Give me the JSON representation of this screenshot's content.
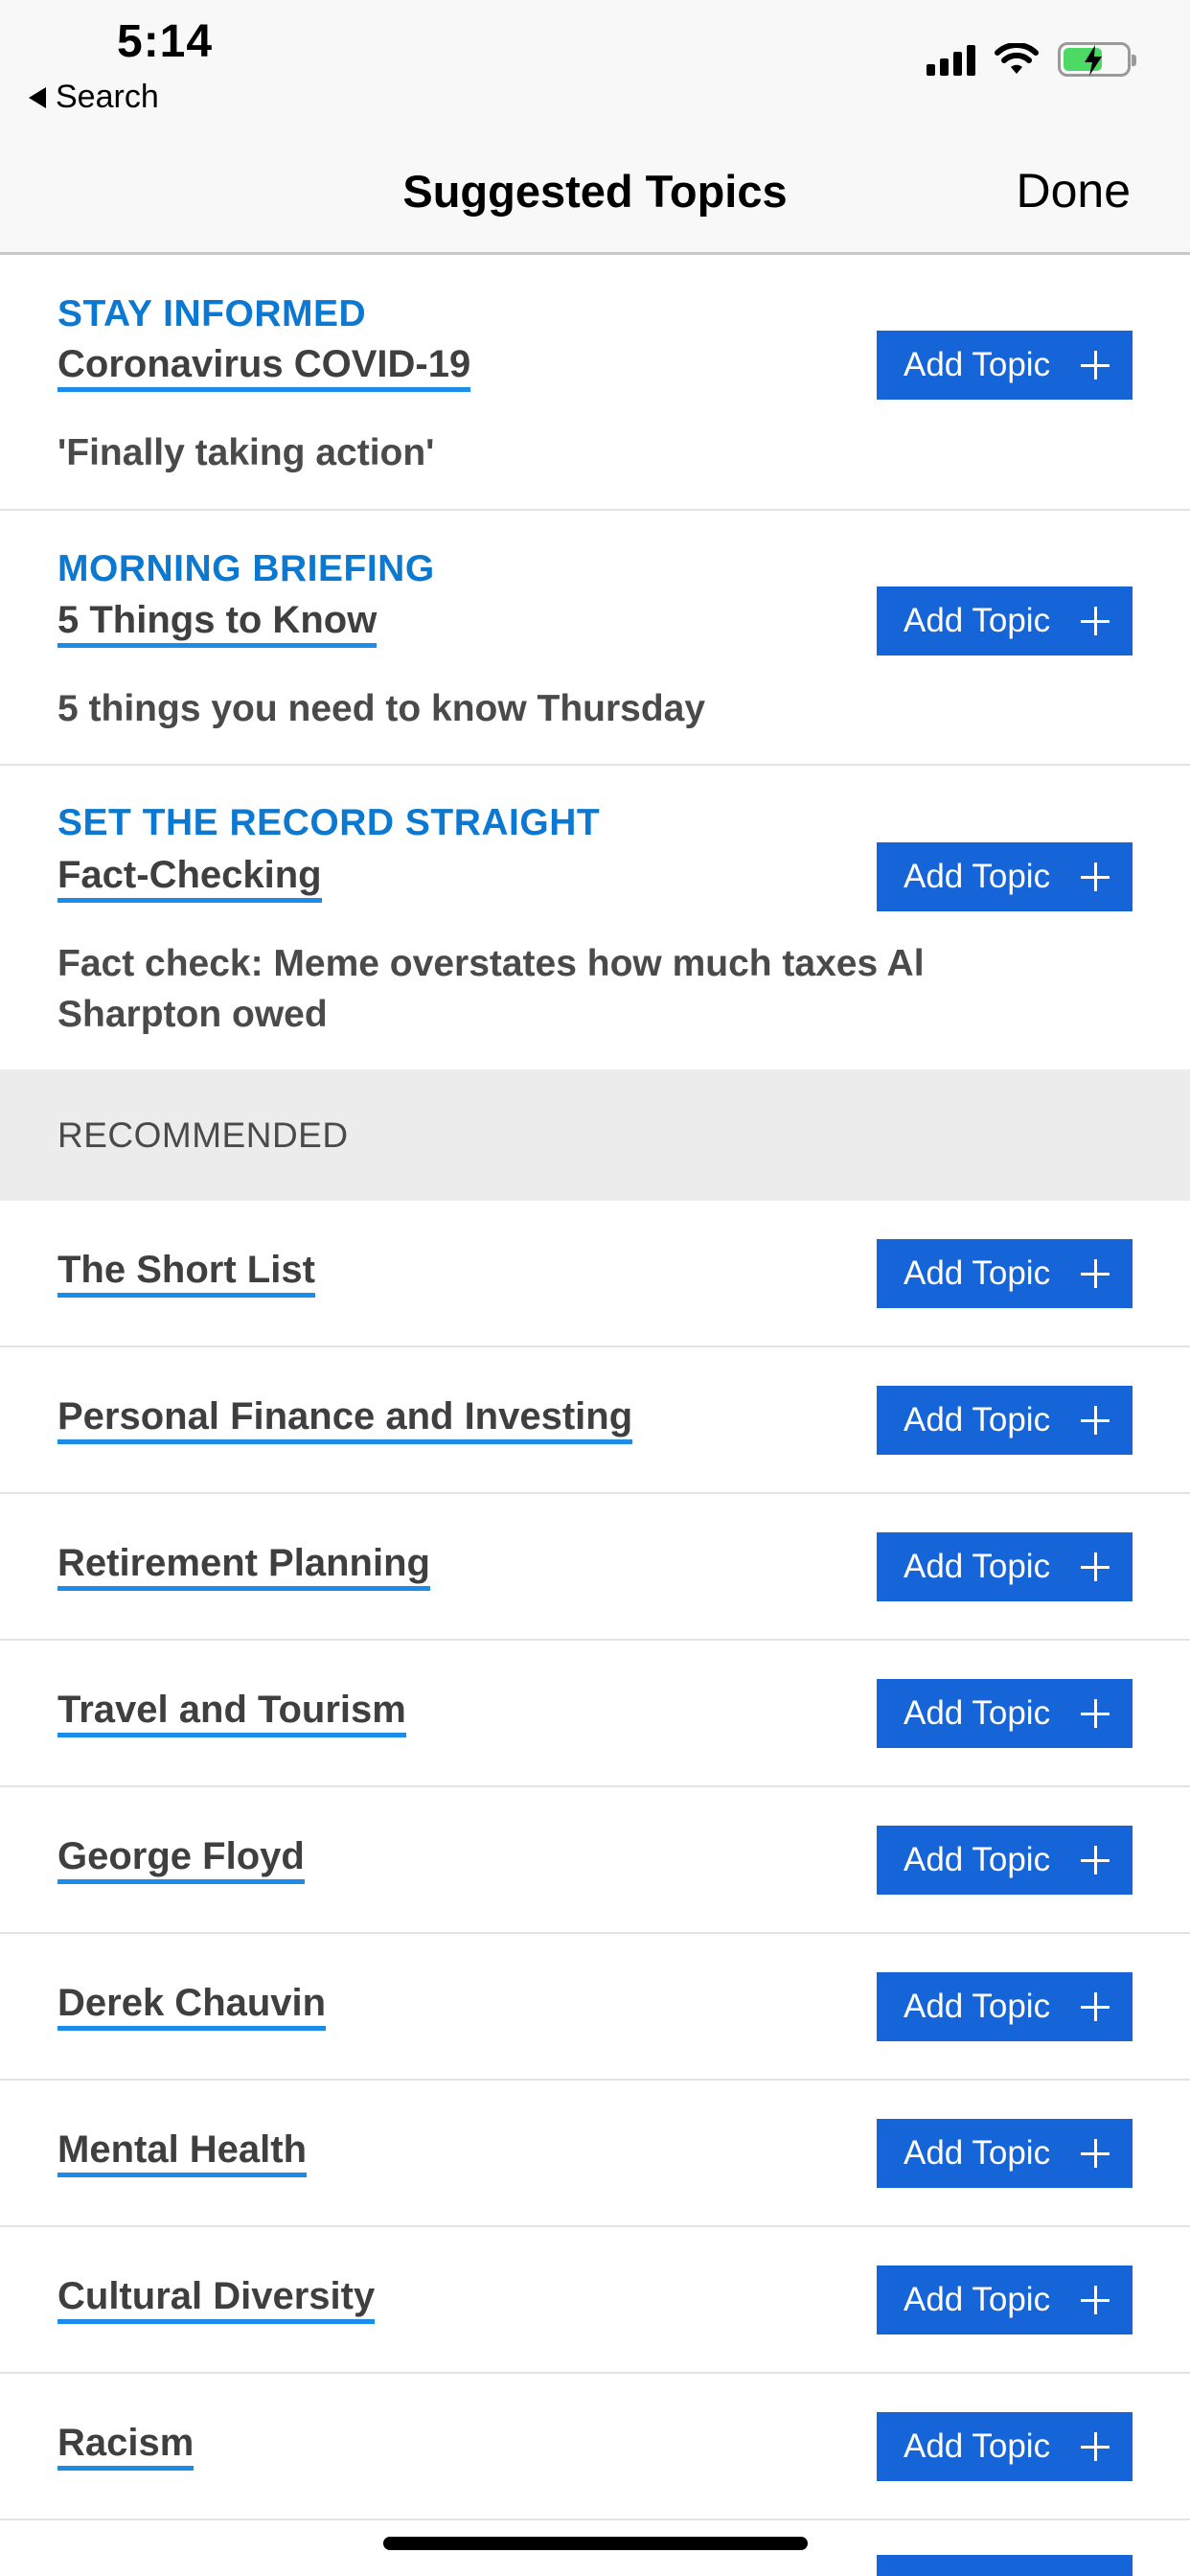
{
  "status_bar": {
    "time": "5:14",
    "back_label": "Search",
    "icons": [
      "signal-icon",
      "wifi-icon",
      "battery-charging-icon"
    ],
    "battery_level": 0.62
  },
  "nav": {
    "title": "Suggested Topics",
    "done_label": "Done"
  },
  "button_label": "Add Topic",
  "suggested": [
    {
      "kicker": "STAY INFORMED",
      "topic": "Coronavirus COVID-19",
      "headline": "'Finally taking action'"
    },
    {
      "kicker": "MORNING BRIEFING",
      "topic": "5 Things to Know",
      "headline": "5 things you need to know Thursday"
    },
    {
      "kicker": "SET THE RECORD STRAIGHT",
      "topic": "Fact-Checking",
      "headline": "Fact check: Meme overstates how much taxes Al Sharpton owed"
    }
  ],
  "recommended": {
    "header": "RECOMMENDED",
    "items": [
      "The Short List",
      "Personal Finance and Investing",
      "Retirement Planning",
      "Travel and Tourism",
      "George Floyd",
      "Derek Chauvin",
      "Mental Health",
      "Cultural Diversity",
      "Racism"
    ]
  },
  "colors": {
    "accent_blue": "#0b78d1",
    "button_blue": "#1565d8",
    "underline_blue": "#1b8ce8",
    "section_bg": "#ececec"
  }
}
